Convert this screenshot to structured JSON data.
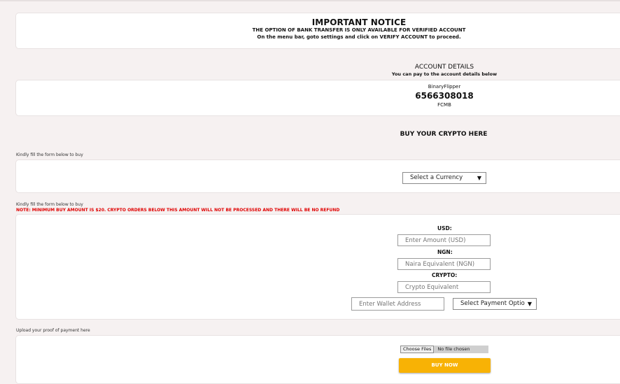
{
  "notice": {
    "title": "IMPORTANT NOTICE",
    "line1": "THE OPTION OF BANK TRANSFER IS ONLY AVAILABLE FOR VERIFIED ACCOUNT",
    "line2": "On the menu bar, goto settings and click on VERIFY ACCOUNT to proceed."
  },
  "account": {
    "title": "ACCOUNT DETAILS",
    "subtitle": "You can pay to the account details below",
    "name": "BinaryFlipper",
    "number": "6566308018",
    "bank": "FCMB"
  },
  "buy": {
    "heading": "BUY YOUR CRYPTO HERE",
    "form_hint_1": "Kindly fill the form below to buy",
    "currency_select": "Select a Currency",
    "form_hint_2": "Kindly fill the form below to buy",
    "warning": "NOTE: MINIMUM BUY AMOUNT IS $20. CRYPTO ORDERS BELOW THIS AMOUNT WILL NOT BE PROCESSED AND THERE WILL BE NO REFUND",
    "usd_label": "USD:",
    "usd_placeholder": "Enter Amount (USD)",
    "ngn_label": "NGN:",
    "ngn_placeholder": "Naira Equivalent (NGN)",
    "crypto_label": "CRYPTO:",
    "crypto_placeholder": "Crypto Equivalent",
    "wallet_placeholder": "Enter Wallet Address",
    "payment_select": "Select Payment Option",
    "upload_hint": "Upload your proof of payment here",
    "choose_files": "Choose Files",
    "no_file": "No file chosen",
    "buy_now": "BUY NOW"
  },
  "colors": {
    "background": "#f6f1f1",
    "button": "#f8b205",
    "warning": "#e00000"
  }
}
